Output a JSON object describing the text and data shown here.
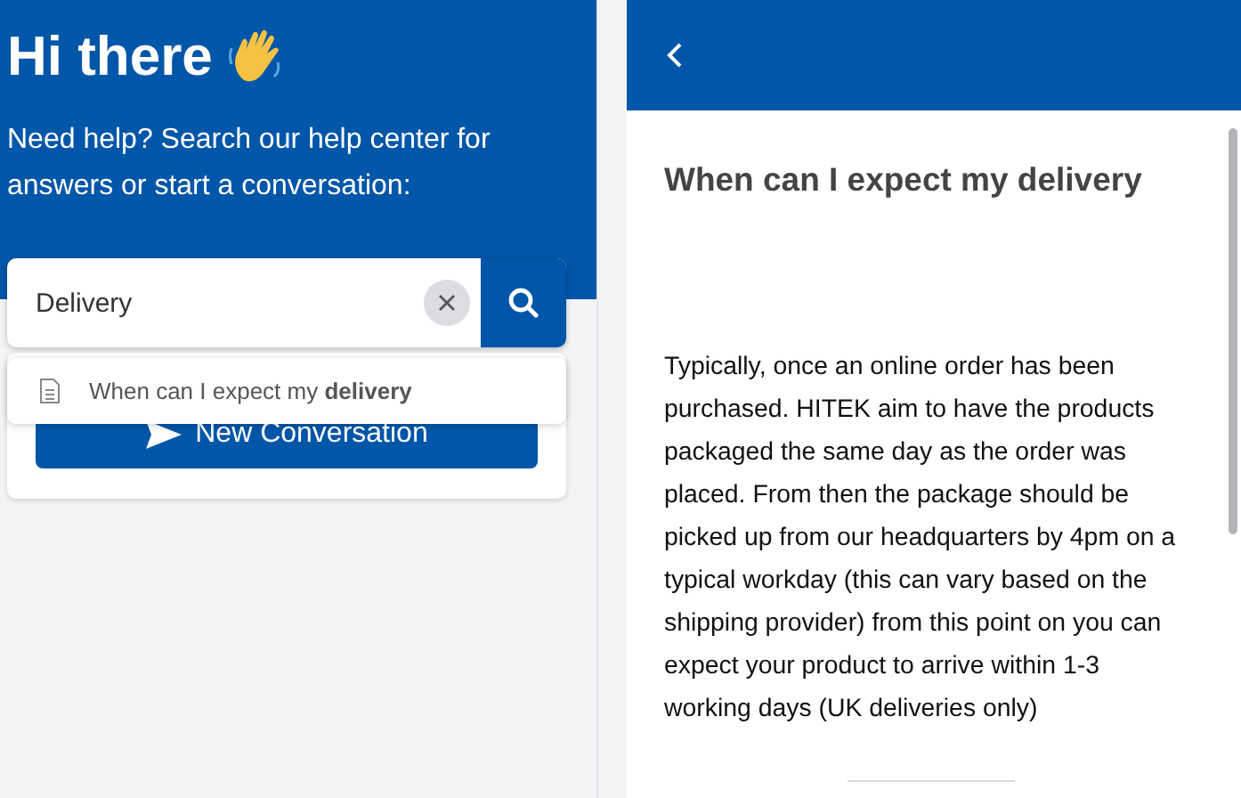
{
  "home": {
    "greeting": "Hi there",
    "subtitle": "Need help? Search our help center for answers or start a conversation:",
    "search": {
      "value": "Delivery"
    },
    "suggestions": [
      {
        "text": "When can I expect my **delivery**"
      }
    ],
    "new_conversation_button": "New Conversation"
  },
  "article": {
    "title": "When can I expect my delivery",
    "body": "Typically, once an online order has been purchased. HITEK aim to have the products packaged the same day as the order was placed. From then the package should be picked up from our headquarters by 4pm on a typical workday (this can vary based on the shipping provider) from this point on you can expect your product to arrive within 1-3 working days (UK deliveries only)"
  }
}
